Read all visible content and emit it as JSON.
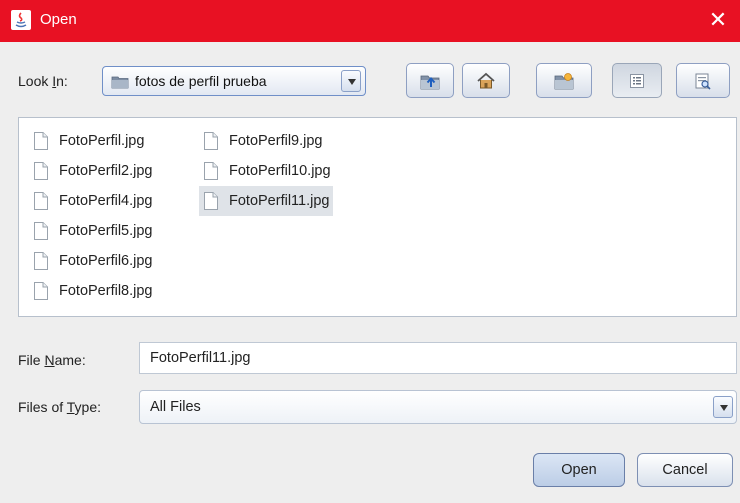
{
  "window": {
    "title": "Open",
    "close_glyph": "✕"
  },
  "look_in": {
    "label_pre": "Look ",
    "label_mnemonic": "I",
    "label_post": "n:",
    "value": "fotos de perfil prueba",
    "icon": "folder-icon"
  },
  "toolbar": {
    "buttons": [
      {
        "name": "up-one-level",
        "icon": "folder-up-icon"
      },
      {
        "name": "home",
        "icon": "home-icon"
      },
      {
        "name": "new-folder",
        "icon": "new-folder-icon"
      },
      {
        "name": "list-view",
        "icon": "list-view-icon",
        "active": true
      },
      {
        "name": "details-view",
        "icon": "details-view-icon",
        "active": false
      }
    ]
  },
  "files": {
    "column1": [
      "FotoPerfil.jpg",
      "FotoPerfil2.jpg",
      "FotoPerfil4.jpg",
      "FotoPerfil5.jpg",
      "FotoPerfil6.jpg",
      "FotoPerfil8.jpg"
    ],
    "column2": [
      "FotoPerfil9.jpg",
      "FotoPerfil10.jpg",
      "FotoPerfil11.jpg"
    ],
    "selected": "FotoPerfil11.jpg"
  },
  "file_name": {
    "label_pre": "File ",
    "label_mnemonic": "N",
    "label_post": "ame:",
    "value": "FotoPerfil11.jpg"
  },
  "file_type": {
    "label_pre": "Files of ",
    "label_mnemonic": "T",
    "label_post": "ype:",
    "value": "All Files"
  },
  "buttons": {
    "open": "Open",
    "cancel": "Cancel"
  },
  "colors": {
    "titlebar": "#e81123",
    "selection": "#dfe3e8"
  }
}
